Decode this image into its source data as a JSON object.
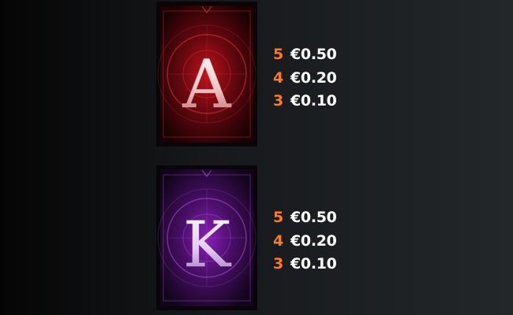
{
  "symbols": [
    {
      "id": "ace",
      "letter": "A",
      "color": "#e0303a",
      "payouts": [
        {
          "count": "5",
          "value": "€0.50"
        },
        {
          "count": "4",
          "value": "€0.20"
        },
        {
          "count": "3",
          "value": "€0.10"
        }
      ]
    },
    {
      "id": "king",
      "letter": "K",
      "color": "#a63ad8",
      "payouts": [
        {
          "count": "5",
          "value": "€0.50"
        },
        {
          "count": "4",
          "value": "€0.20"
        },
        {
          "count": "3",
          "value": "€0.10"
        }
      ]
    }
  ],
  "colors": {
    "count_text": "#ff7a22",
    "value_text": "#ffffff",
    "card_frame": "#0b0b0c"
  }
}
